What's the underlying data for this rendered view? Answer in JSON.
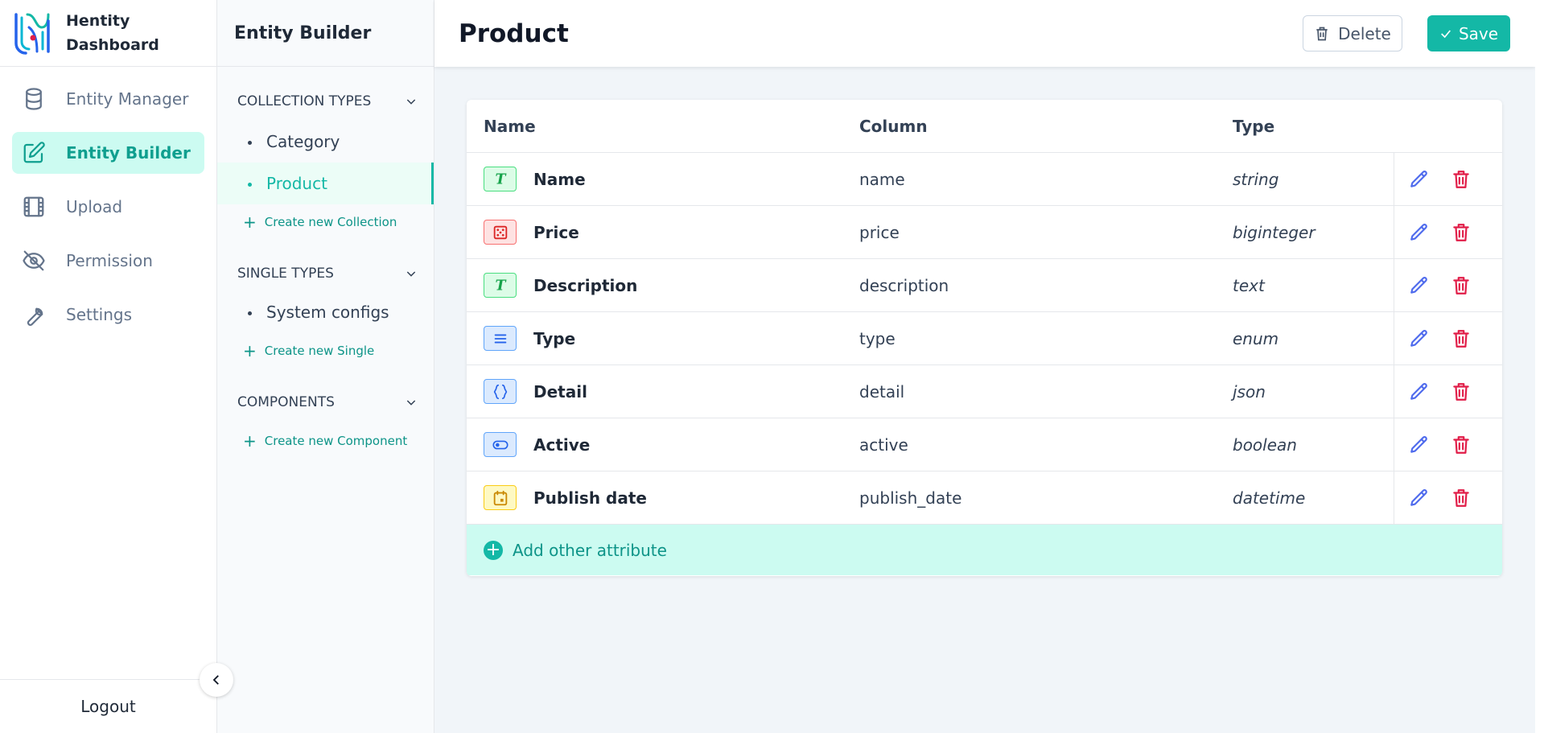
{
  "brand": {
    "line1": "Hentity",
    "line2": "Dashboard"
  },
  "nav": {
    "items": [
      {
        "label": "Entity Manager",
        "icon": "database-icon"
      },
      {
        "label": "Entity Builder",
        "icon": "edit-icon",
        "active": true
      },
      {
        "label": "Upload",
        "icon": "film-icon"
      },
      {
        "label": "Permission",
        "icon": "eye-off-icon"
      },
      {
        "label": "Settings",
        "icon": "wrench-icon"
      }
    ],
    "logout": "Logout"
  },
  "builder": {
    "title": "Entity Builder",
    "sections": [
      {
        "title": "COLLECTION TYPES",
        "items": [
          "Category",
          "Product"
        ],
        "active_item": "Product",
        "create_label": "Create new Collection"
      },
      {
        "title": "SINGLE TYPES",
        "items": [
          "System configs"
        ],
        "create_label": "Create new Single"
      },
      {
        "title": "COMPONENTS",
        "items": [],
        "create_label": "Create new Component"
      }
    ]
  },
  "header": {
    "title": "Product",
    "delete_label": "Delete",
    "save_label": "Save"
  },
  "table": {
    "columns": [
      "Name",
      "Column",
      "Type"
    ],
    "rows": [
      {
        "name": "Name",
        "column": "name",
        "type": "string",
        "icon": "text-type-icon"
      },
      {
        "name": "Price",
        "column": "price",
        "type": "biginteger",
        "icon": "number-type-icon"
      },
      {
        "name": "Description",
        "column": "description",
        "type": "text",
        "icon": "text-type-icon"
      },
      {
        "name": "Type",
        "column": "type",
        "type": "enum",
        "icon": "enum-type-icon"
      },
      {
        "name": "Detail",
        "column": "detail",
        "type": "json",
        "icon": "json-type-icon"
      },
      {
        "name": "Active",
        "column": "active",
        "type": "boolean",
        "icon": "boolean-type-icon"
      },
      {
        "name": "Publish date",
        "column": "publish_date",
        "type": "datetime",
        "icon": "date-type-icon"
      }
    ],
    "add_label": "Add other attribute"
  },
  "colors": {
    "accent": "#14b8a6",
    "accent_light": "#ccfbf1",
    "edit": "#4f6bed",
    "delete": "#e11d48"
  }
}
